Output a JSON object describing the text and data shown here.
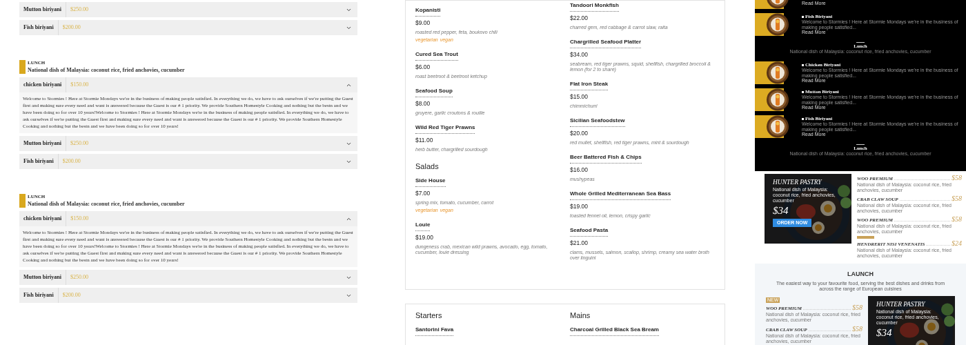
{
  "accordion_menu": {
    "sections": [
      {
        "kind": "continued",
        "items": [
          {
            "name": "Mutton biriyani",
            "price": "$250.00",
            "expanded": false
          },
          {
            "name": "Fish biriyani",
            "price": "$200.00",
            "expanded": false
          }
        ]
      },
      {
        "kind": "group",
        "label": "LUNCH",
        "subtitle": "National dish of Malaysia: coconut rice, fried anchovies, cucumber",
        "items": [
          {
            "name": "chicken biriyani",
            "price": "$150.00",
            "expanded": true,
            "body": "Welcome to Stormies ! Here at Stormie Mondays we're in the business of making people satisfied. In everything we do, we have to ask ourselves if we're putting the Guest first and making sure every need and want is answered because the Guest is our # 1 priority. We provide Southern Homestyle Cooking and nothing but the bestn and we have been doing so for over 10 years!Welcome to Stormies ! Here at Stormie Mondays we're in the business of making people satisfied. In everything we do, we have to ask ourselves if we're putting the Guest first and making sure every need and want is answered because the Guest is our # 1 priority. We provide Southern Homestyle Cooking and nothing but the bestn and we have been doing so for over 10 years!"
          },
          {
            "name": "Mutton biriyani",
            "price": "$250.00",
            "expanded": false
          },
          {
            "name": "Fish biriyani",
            "price": "$200.00",
            "expanded": false
          }
        ]
      },
      {
        "kind": "group",
        "label": "LUNCH",
        "subtitle": "National dish of Malaysia: coconut rice, fried anchovies, cucumber",
        "items": [
          {
            "name": "chicken biriyani",
            "price": "$150.00",
            "expanded": true,
            "body": "Welcome to Stormies ! Here at Stormie Mondays we're in the business of making people satisfied. In everything we do, we have to ask ourselves if we're putting the Guest first and making sure every need and want is answered because the Guest is our # 1 priority. We provide Southern Homestyle Cooking and nothing but the bestn and we have been doing so for over 10 years!Welcome to Stormies ! Here at Stormie Mondays we're in the business of making people satisfied. In everything we do, we have to ask ourselves if we're putting the Guest first and making sure every need and want is answered because the Guest is our # 1 priority. We provide Southern Homestyle Cooking and nothing but the bestn and we have been doing so for over 10 years!"
          },
          {
            "name": "Mutton biriyani",
            "price": "$250.00",
            "expanded": false
          },
          {
            "name": "Fish biriyani",
            "price": "$200.00",
            "expanded": false
          }
        ]
      }
    ]
  },
  "menu_cards": [
    {
      "columns": [
        {
          "entries": [
            {
              "kind": "item",
              "name": "Kopanisti",
              "price": "$9.00",
              "description": "roasted red pepper, feta, boukovo chili",
              "tags": [
                "vegetarian",
                "vegan"
              ]
            },
            {
              "kind": "item",
              "name": "Cured Sea Trout",
              "price": "$6.00",
              "description": "roast beetroot & beetroot ketchup"
            },
            {
              "kind": "item",
              "name": "Seafood Soup",
              "price": "$8.00",
              "description": "gruyere, garlic croutons & rouille"
            },
            {
              "kind": "item",
              "name": "Wild Red Tiger Prawns",
              "price": "$11.00",
              "description": "herb butter, chargrilled sourdough"
            },
            {
              "kind": "heading",
              "text": "Salads"
            },
            {
              "kind": "item",
              "name": "Side House",
              "price": "$7.00",
              "description": "spring mix, tomato, cucumber, carrot",
              "tags": [
                "vegetarian",
                "vegan"
              ]
            },
            {
              "kind": "item",
              "name": "Louie",
              "price": "$19.00",
              "description": "dungeness crab, mexican wild prawns, avocado, egg, tomato, cucumber, louie dressing"
            }
          ]
        },
        {
          "entries": [
            {
              "kind": "item",
              "name": "Tandoori Monkfish",
              "price": "$22.00",
              "description": "charred gem, red cabbage & carrot slaw, raita"
            },
            {
              "kind": "item",
              "name": "Chargrilled Seafood Platter",
              "price": "$34.00",
              "description": "seabream, red tiger prawns, squid, shellfish, chargrilled broccoli & lemon (for 2 to share)"
            },
            {
              "kind": "item",
              "name": "Flat Iron Steak",
              "price": "$15.00",
              "description": "chimmichurri"
            },
            {
              "kind": "item",
              "name": "Sicilian Seafoodstew",
              "price": "$20.00",
              "description": "red mullet, shellfish, red tiger prawns, mint & sourdough"
            },
            {
              "kind": "item",
              "name": "Beer Battered Fish & Chips",
              "price": "$16.00",
              "description": "mushypeas"
            },
            {
              "kind": "item",
              "name": "Whole Grilled Mediterranean Sea Bass",
              "price": "$19.00",
              "description": "toasted fennel oil, lemon, crispy garlic"
            },
            {
              "kind": "item",
              "name": "Seafood Pasta",
              "price": "$21.00",
              "description": "clams, mussels, salmon, scallop, shrimp, creamy sea water broth over linguini"
            }
          ]
        }
      ]
    },
    {
      "columns": [
        {
          "entries": [
            {
              "kind": "heading",
              "text": "Starters"
            },
            {
              "kind": "item",
              "name": "Santorini Fava"
            }
          ]
        },
        {
          "entries": [
            {
              "kind": "heading",
              "text": "Mains"
            },
            {
              "kind": "item",
              "name": "Charcoal Grilled Black Sea Bream"
            }
          ]
        }
      ]
    }
  ],
  "dark_menu": {
    "blocks": [
      {
        "kind": "dish",
        "read_more": "Read More"
      },
      {
        "kind": "dish",
        "title": "Fish Biriyani",
        "description": "Welcome to Stormies ! Here at Stormie Mondays we're in the business of making people satisfied...",
        "read_more": "Read More"
      },
      {
        "kind": "heading",
        "title": "Lunch",
        "subtitle": "National dish of Malaysia: coconut rice, fried anchovies, cucumber"
      },
      {
        "kind": "dish",
        "title": "Chicken Biriyani",
        "description": "Welcome to Stormies ! Here at Stormie Mondays we're in the business of making people satisfied...",
        "read_more": "Read More"
      },
      {
        "kind": "dish",
        "title": "Mutton Biriyani",
        "description": "Welcome to Stormies ! Here at Stormie Mondays we're in the business of making people satisfied...",
        "read_more": "Read More"
      },
      {
        "kind": "dish",
        "title": "Fish Biriyani",
        "description": "Welcome to Stormies ! Here at Stormie Mondays we're in the business of making people satisfied...",
        "read_more": "Read More"
      },
      {
        "kind": "heading",
        "title": "Lunch",
        "subtitle": "National dish of Malaysia: coconut rice, fried anchovies, cucumber"
      }
    ]
  },
  "pastry_section": {
    "feature": {
      "title": "HUNTER PASTRY",
      "description": "National dish of Malaysia: coconut rice, fried anchovies, cucumber",
      "price": "$34",
      "button": "ORDER NOW"
    },
    "items": [
      {
        "name": "WOO PREMIUM",
        "price": "$58",
        "description": "National dish of Malaysia: coconut rice, fried anchovies, cucumber",
        "tagged": false
      },
      {
        "name": "CRAB CLAW SOUP",
        "price": "$58",
        "description": "National dish of Malaysia: coconut rice, fried anchovies, cucumber",
        "tagged": false
      },
      {
        "name": "WOO PREMIUM",
        "price": "$58",
        "description": "National dish of Malaysia: coconut rice, fried anchovies, cucumber",
        "tagged": false
      },
      {
        "name": "HENDRERIT NISI VENENATIS",
        "price": "$24",
        "description": "National dish of Malaysia: coconut rice, fried anchovies, cucumber",
        "tagged": true
      }
    ]
  },
  "launch_section": {
    "title": "LAUNCH",
    "subtitle": "The easiest way to your favourite food, serving the best dishes and drinks from across the range of European cuisines",
    "items": [
      {
        "badge": "NEW",
        "name": "WOO PREMIUM",
        "price": "$58",
        "description": "National dish of Malaysia: coconut rice, fried anchovies, cucumber"
      },
      {
        "name": "CRAB CLAW SOUP",
        "price": "$58",
        "description": "National dish of Malaysia: coconut rice, fried anchovies, cucumber"
      }
    ],
    "feature": {
      "title": "HUNTER PASTRY",
      "description": "National dish of Malaysia: coconut rice, fried anchovies, cucumber",
      "price": "$34"
    }
  }
}
